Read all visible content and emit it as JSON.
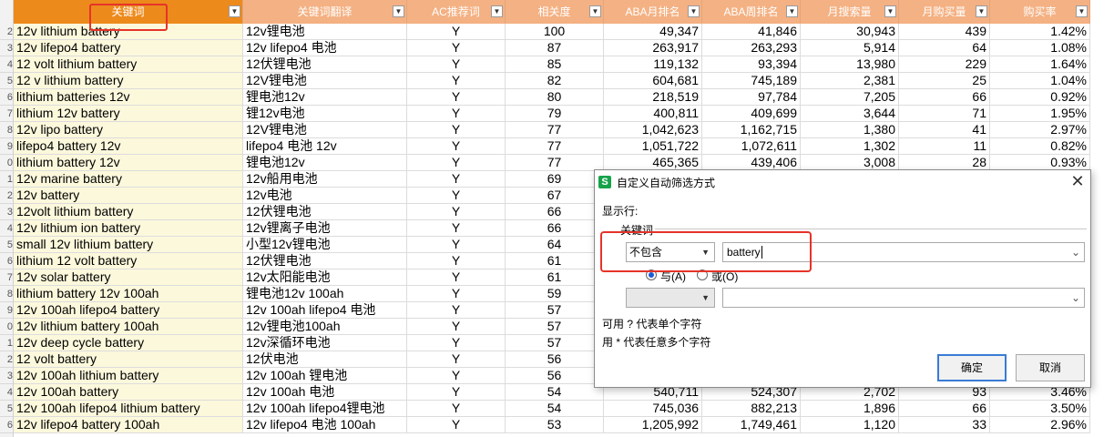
{
  "sheet": {
    "headers": [
      "关键词",
      "关键词翻译",
      "AC推荐词",
      "相关度",
      "ABA月排名",
      "ABA周排名",
      "月搜索量",
      "月购买量",
      "购买率"
    ],
    "rows": [
      [
        "12v lithium battery",
        "12v锂电池",
        "Y",
        "100",
        "49,347",
        "41,846",
        "30,943",
        "439",
        "1.42%"
      ],
      [
        "12v lifepo4 battery",
        "12v lifepo4 电池",
        "Y",
        "87",
        "263,917",
        "263,293",
        "5,914",
        "64",
        "1.08%"
      ],
      [
        "12 volt lithium battery",
        "12伏锂电池",
        "Y",
        "85",
        "119,132",
        "93,394",
        "13,980",
        "229",
        "1.64%"
      ],
      [
        "12 v lithium battery",
        "12V锂电池",
        "Y",
        "82",
        "604,681",
        "745,189",
        "2,381",
        "25",
        "1.04%"
      ],
      [
        "lithium batteries 12v",
        "锂电池12v",
        "Y",
        "80",
        "218,519",
        "97,784",
        "7,205",
        "66",
        "0.92%"
      ],
      [
        "lithium 12v battery",
        "锂12v电池",
        "Y",
        "79",
        "400,811",
        "409,699",
        "3,644",
        "71",
        "1.95%"
      ],
      [
        "12v lipo battery",
        "12V锂电池",
        "Y",
        "77",
        "1,042,623",
        "1,162,715",
        "1,380",
        "41",
        "2.97%"
      ],
      [
        "lifepo4 battery 12v",
        "lifepo4 电池 12v",
        "Y",
        "77",
        "1,051,722",
        "1,072,611",
        "1,302",
        "11",
        "0.82%"
      ],
      [
        "lithium battery 12v",
        "锂电池12v",
        "Y",
        "77",
        "465,365",
        "439,406",
        "3,008",
        "28",
        "0.93%"
      ],
      [
        "12v marine battery",
        "12v船用电池",
        "Y",
        "69",
        "",
        "",
        "",
        "",
        ""
      ],
      [
        "12v battery",
        "12v电池",
        "Y",
        "67",
        "",
        "",
        "",
        "",
        ""
      ],
      [
        "12volt lithium battery",
        "12伏锂电池",
        "Y",
        "66",
        "",
        "",
        "",
        "",
        ""
      ],
      [
        "12v lithium ion battery",
        "12v锂离子电池",
        "Y",
        "66",
        "",
        "",
        "",
        "",
        ""
      ],
      [
        "small 12v lithium battery",
        "小型12v锂电池",
        "Y",
        "64",
        "",
        "",
        "",
        "",
        ""
      ],
      [
        "lithium 12 volt battery",
        "12伏锂电池",
        "Y",
        "61",
        "",
        "",
        "",
        "",
        ""
      ],
      [
        "12v solar battery",
        "12v太阳能电池",
        "Y",
        "61",
        "",
        "",
        "",
        "",
        ""
      ],
      [
        "lithium battery 12v 100ah",
        "锂电池12v 100ah",
        "Y",
        "59",
        "",
        "",
        "",
        "",
        ""
      ],
      [
        "12v 100ah lifepo4 battery",
        "12v 100ah lifepo4 电池",
        "Y",
        "57",
        "",
        "",
        "",
        "",
        ""
      ],
      [
        "12v lithium battery 100ah",
        "12v锂电池100ah",
        "Y",
        "57",
        "",
        "",
        "",
        "",
        ""
      ],
      [
        "12v deep cycle battery",
        "12v深循环电池",
        "Y",
        "57",
        "",
        "",
        "",
        "",
        ""
      ],
      [
        "12 volt battery",
        "12伏电池",
        "Y",
        "56",
        "",
        "",
        "",
        "",
        ""
      ],
      [
        "12v 100ah lithium battery",
        "12v 100ah 锂电池",
        "Y",
        "56",
        "",
        "",
        "",
        "",
        ""
      ],
      [
        "12v 100ah battery",
        "12v 100ah 电池",
        "Y",
        "54",
        "540,711",
        "524,307",
        "2,702",
        "93",
        "3.46%"
      ],
      [
        "12v 100ah lifepo4 lithium battery",
        "12v 100ah lifepo4锂电池",
        "Y",
        "54",
        "745,036",
        "882,213",
        "1,896",
        "66",
        "3.50%"
      ],
      [
        "12v lifepo4 battery 100ah",
        "12v lifepo4 电池 100ah",
        "Y",
        "53",
        "1,205,992",
        "1,749,461",
        "1,120",
        "33",
        "2.96%"
      ]
    ],
    "row_numbers": [
      "2",
      "3",
      "4",
      "5",
      "6",
      "7",
      "8",
      "9",
      "0",
      "1",
      "2",
      "3",
      "4",
      "5",
      "6",
      "7",
      "8",
      "9",
      "0",
      "1",
      "2",
      "3",
      "4",
      "5",
      "6"
    ]
  },
  "dialog": {
    "title": "自定义自动筛选方式",
    "app_icon": "S",
    "show_rows_label": "显示行:",
    "field_label": "关键词",
    "operator1": "不包含",
    "value1": "battery",
    "and_label": "与(A)",
    "or_label": "或(O)",
    "operator2": "",
    "value2": "",
    "hint1": "可用 ? 代表单个字符",
    "hint2": "用 * 代表任意多个字符",
    "ok_label": "确定",
    "cancel_label": "取消"
  }
}
